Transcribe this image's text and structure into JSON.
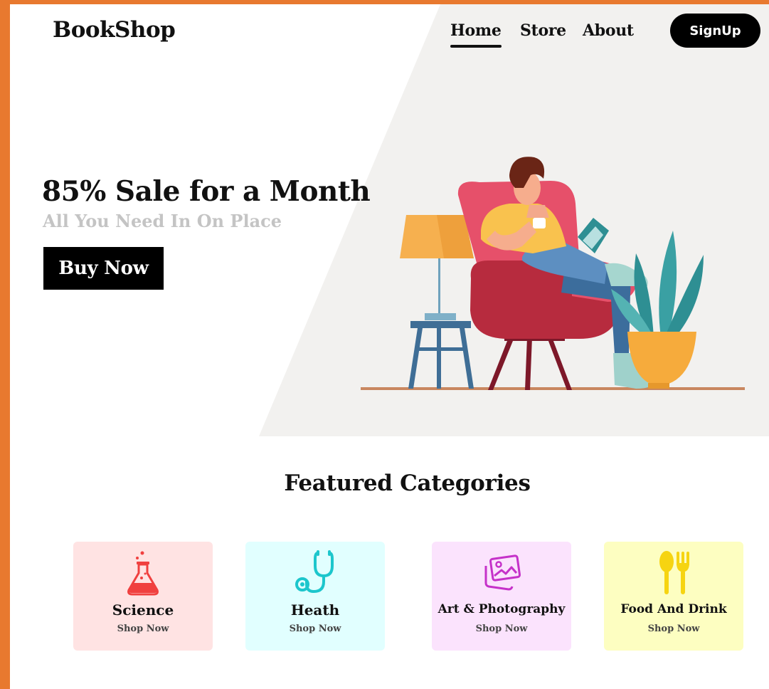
{
  "brand": {
    "logo": "BookShop"
  },
  "nav": {
    "items": [
      {
        "label": "Home",
        "active": true
      },
      {
        "label": "Store",
        "active": false
      },
      {
        "label": "About",
        "active": false
      }
    ],
    "signup_label": "SignUp"
  },
  "hero": {
    "headline": "85% Sale for a Month",
    "subline": "All You Need In On Place",
    "cta_label": "Buy Now"
  },
  "featured": {
    "title": "Featured Categories",
    "categories": [
      {
        "name": "Science",
        "action": "Shop Now",
        "icon": "flask-icon",
        "bg": "#ffe3e3",
        "color": "#f0403f"
      },
      {
        "name": "Heath",
        "action": "Shop Now",
        "icon": "stethoscope-icon",
        "bg": "#e1ffff",
        "color": "#1cc6cc"
      },
      {
        "name": "Art & Photography",
        "action": "Shop Now",
        "icon": "image-icon",
        "bg": "#fbe3fd",
        "color": "#c531c9"
      },
      {
        "name": "Food And Drink",
        "action": "Shop Now",
        "icon": "spoon-fork-icon",
        "bg": "#fdfec1",
        "color": "#f6d411"
      }
    ]
  },
  "colors": {
    "frame": "#e8792f",
    "hero_panel": "#f2f1ef",
    "text": "#111111"
  }
}
